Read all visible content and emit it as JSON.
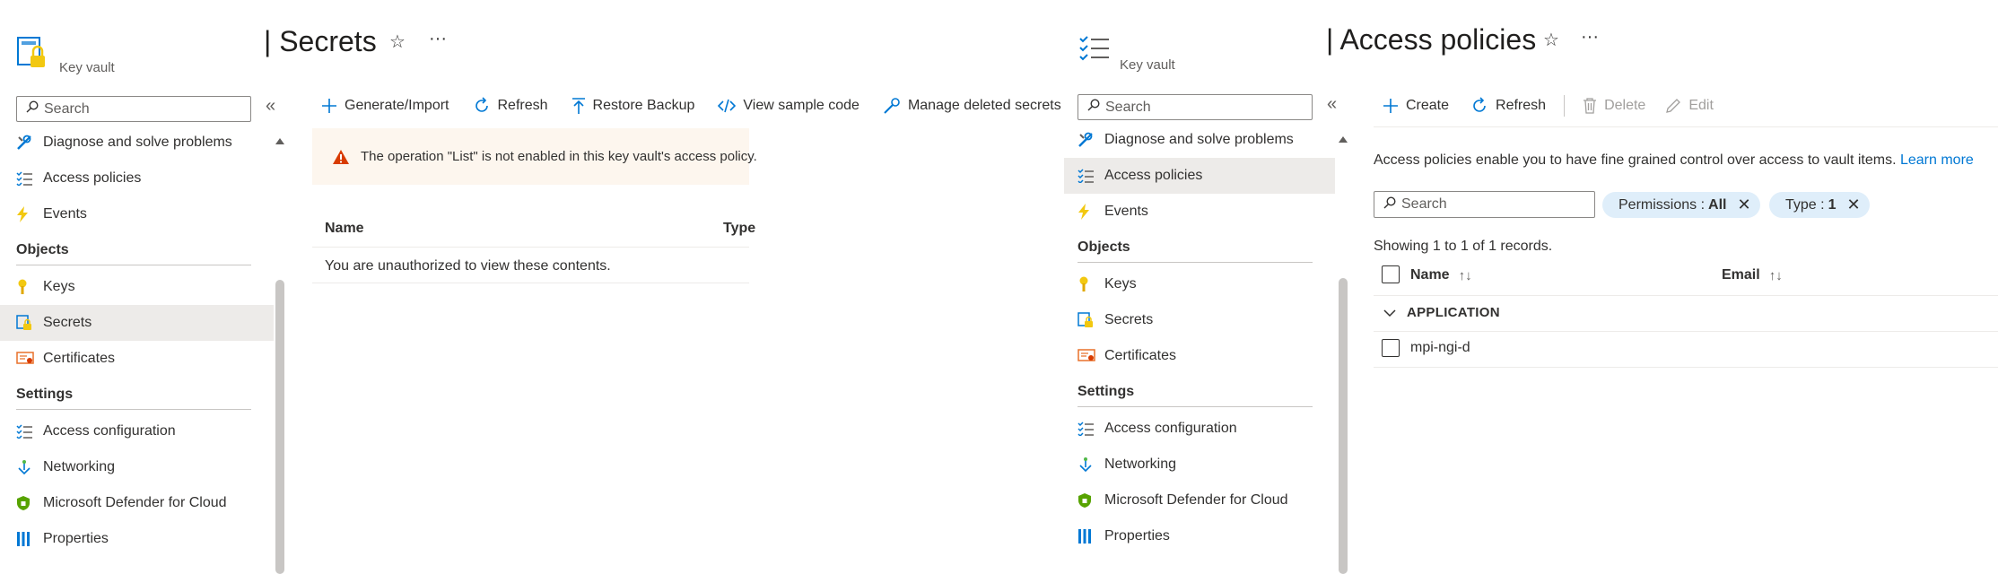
{
  "left": {
    "service_label": "Key vault",
    "blade_title": "| Secrets",
    "search_placeholder": "Search",
    "collapse_glyph": "«",
    "nav": [
      {
        "label": "Diagnose and solve problems",
        "icon": "wrench-icon"
      },
      {
        "label": "Access policies",
        "icon": "list-check-icon"
      },
      {
        "label": "Events",
        "icon": "lightning-icon"
      }
    ],
    "objects_heading": "Objects",
    "objects": [
      {
        "label": "Keys",
        "icon": "key-icon"
      },
      {
        "label": "Secrets",
        "icon": "secret-icon",
        "selected": true
      },
      {
        "label": "Certificates",
        "icon": "certificate-icon"
      }
    ],
    "settings_heading": "Settings",
    "settings": [
      {
        "label": "Access configuration",
        "icon": "list-check-icon"
      },
      {
        "label": "Networking",
        "icon": "network-icon"
      },
      {
        "label": "Microsoft Defender for Cloud",
        "icon": "shield-icon"
      },
      {
        "label": "Properties",
        "icon": "properties-icon"
      }
    ],
    "commands": {
      "generate": "Generate/Import",
      "refresh": "Refresh",
      "restore": "Restore Backup",
      "sample": "View sample code",
      "deleted": "Manage deleted secrets"
    },
    "warning": "The operation \"List\" is not enabled in this key vault's access policy.",
    "table": {
      "col_name": "Name",
      "col_type": "Type",
      "empty_message": "You are unauthorized to view these contents."
    }
  },
  "right": {
    "service_label": "Key vault",
    "blade_title": "| Access policies",
    "search_placeholder": "Search",
    "collapse_glyph": "«",
    "nav": [
      {
        "label": "Diagnose and solve problems",
        "icon": "wrench-icon"
      },
      {
        "label": "Access policies",
        "icon": "list-check-icon",
        "selected": true
      },
      {
        "label": "Events",
        "icon": "lightning-icon"
      }
    ],
    "objects_heading": "Objects",
    "objects": [
      {
        "label": "Keys",
        "icon": "key-icon"
      },
      {
        "label": "Secrets",
        "icon": "secret-icon"
      },
      {
        "label": "Certificates",
        "icon": "certificate-icon"
      }
    ],
    "settings_heading": "Settings",
    "settings": [
      {
        "label": "Access configuration",
        "icon": "list-check-icon"
      },
      {
        "label": "Networking",
        "icon": "network-icon"
      },
      {
        "label": "Microsoft Defender for Cloud",
        "icon": "shield-icon"
      },
      {
        "label": "Properties",
        "icon": "properties-icon"
      }
    ],
    "commands": {
      "create": "Create",
      "refresh": "Refresh",
      "delete": "Delete",
      "edit": "Edit"
    },
    "description": "Access policies enable you to have fine grained control over access to vault items.",
    "learn_more": "Learn more",
    "filter_search_placeholder": "Search",
    "pills": [
      {
        "label": "Permissions :",
        "value": "All"
      },
      {
        "label": "Type :",
        "value": "1"
      }
    ],
    "records": "Showing 1 to 1 of 1 records.",
    "table": {
      "col_name": "Name",
      "col_email": "Email",
      "group": "APPLICATION",
      "row_name": "mpi-ngi-d"
    }
  },
  "colors": {
    "accent": "#0078d4",
    "selected_bg": "#edebe9",
    "warning_bg": "#fdf6ee",
    "warning_icon": "#d83b01",
    "pill_bg": "#dfeefa"
  }
}
